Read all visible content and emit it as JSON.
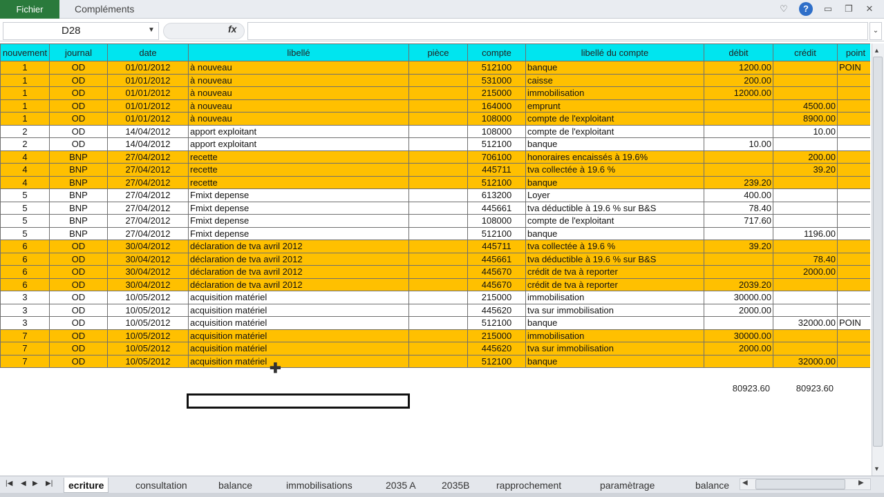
{
  "ribbon": {
    "fichier_label": "Fichier",
    "complements_label": "Compléments"
  },
  "formula_bar": {
    "name_box": "D28",
    "fx_symbol": "fx",
    "formula": ""
  },
  "table": {
    "headers": [
      "nouvement",
      "journal",
      "date",
      "libellé",
      "pièce",
      "compte",
      "libellé du compte",
      "débit",
      "crédit",
      "point"
    ],
    "rows": [
      {
        "style": "orange",
        "cells": [
          "1",
          "OD",
          "01/01/2012",
          "à nouveau",
          "",
          "512100",
          "banque",
          "1200.00",
          "",
          "POIN"
        ]
      },
      {
        "style": "orange",
        "cells": [
          "1",
          "OD",
          "01/01/2012",
          "à nouveau",
          "",
          "531000",
          "caisse",
          "200.00",
          "",
          ""
        ]
      },
      {
        "style": "orange",
        "cells": [
          "1",
          "OD",
          "01/01/2012",
          "à nouveau",
          "",
          "215000",
          "immobilisation",
          "12000.00",
          "",
          ""
        ]
      },
      {
        "style": "orange",
        "cells": [
          "1",
          "OD",
          "01/01/2012",
          "à nouveau",
          "",
          "164000",
          "emprunt",
          "",
          "4500.00",
          ""
        ]
      },
      {
        "style": "orange",
        "cells": [
          "1",
          "OD",
          "01/01/2012",
          "à nouveau",
          "",
          "108000",
          "compte de l'exploitant",
          "",
          "8900.00",
          ""
        ]
      },
      {
        "style": "white",
        "cells": [
          "2",
          "OD",
          "14/04/2012",
          "apport exploitant",
          "",
          "108000",
          "compte de l'exploitant",
          "",
          "10.00",
          ""
        ]
      },
      {
        "style": "white",
        "cells": [
          "2",
          "OD",
          "14/04/2012",
          "apport exploitant",
          "",
          "512100",
          "banque",
          "10.00",
          "",
          ""
        ]
      },
      {
        "style": "orange",
        "cells": [
          "4",
          "BNP",
          "27/04/2012",
          "recette",
          "",
          "706100",
          "honoraires encaissés à 19.6%",
          "",
          "200.00",
          ""
        ]
      },
      {
        "style": "orange",
        "cells": [
          "4",
          "BNP",
          "27/04/2012",
          "recette",
          "",
          "445711",
          "tva collectée à 19.6 %",
          "",
          "39.20",
          ""
        ]
      },
      {
        "style": "orange",
        "cells": [
          "4",
          "BNP",
          "27/04/2012",
          "recette",
          "",
          "512100",
          "banque",
          "239.20",
          "",
          ""
        ]
      },
      {
        "style": "white",
        "cells": [
          "5",
          "BNP",
          "27/04/2012",
          "Fmixt depense",
          "",
          "613200",
          "Loyer",
          "400.00",
          "",
          ""
        ]
      },
      {
        "style": "white",
        "cells": [
          "5",
          "BNP",
          "27/04/2012",
          "Fmixt depense",
          "",
          "445661",
          "tva déductible à 19.6 % sur B&S",
          "78.40",
          "",
          ""
        ]
      },
      {
        "style": "white",
        "cells": [
          "5",
          "BNP",
          "27/04/2012",
          "Fmixt depense",
          "",
          "108000",
          "compte de l'exploitant",
          "717.60",
          "",
          ""
        ]
      },
      {
        "style": "white",
        "cells": [
          "5",
          "BNP",
          "27/04/2012",
          "Fmixt depense",
          "",
          "512100",
          "banque",
          "",
          "1196.00",
          ""
        ]
      },
      {
        "style": "orange",
        "cells": [
          "6",
          "OD",
          "30/04/2012",
          "déclaration de tva avril 2012",
          "",
          "445711",
          "tva collectée à 19.6 %",
          "39.20",
          "",
          ""
        ]
      },
      {
        "style": "orange",
        "cells": [
          "6",
          "OD",
          "30/04/2012",
          "déclaration de tva avril 2012",
          "",
          "445661",
          "tva déductible à 19.6 % sur B&S",
          "",
          "78.40",
          ""
        ]
      },
      {
        "style": "orange",
        "cells": [
          "6",
          "OD",
          "30/04/2012",
          "déclaration de tva avril 2012",
          "",
          "445670",
          "crédit de tva à reporter",
          "",
          "2000.00",
          ""
        ]
      },
      {
        "style": "orange",
        "cells": [
          "6",
          "OD",
          "30/04/2012",
          "déclaration de tva avril 2012",
          "",
          "445670",
          "crédit de tva à reporter",
          "2039.20",
          "",
          ""
        ]
      },
      {
        "style": "white",
        "cells": [
          "3",
          "OD",
          "10/05/2012",
          "acquisition matériel",
          "",
          "215000",
          "immobilisation",
          "30000.00",
          "",
          ""
        ]
      },
      {
        "style": "white",
        "cells": [
          "3",
          "OD",
          "10/05/2012",
          "acquisition matériel",
          "",
          "445620",
          "tva sur immobilisation",
          "2000.00",
          "",
          ""
        ]
      },
      {
        "style": "white",
        "cells": [
          "3",
          "OD",
          "10/05/2012",
          "acquisition matériel",
          "",
          "512100",
          "banque",
          "",
          "32000.00",
          "POIN"
        ]
      },
      {
        "style": "orange",
        "cells": [
          "7",
          "OD",
          "10/05/2012",
          "acquisition matériel",
          "",
          "215000",
          "immobilisation",
          "30000.00",
          "",
          ""
        ]
      },
      {
        "style": "orange",
        "cells": [
          "7",
          "OD",
          "10/05/2012",
          "acquisition matériel",
          "",
          "445620",
          "tva sur immobilisation",
          "2000.00",
          "",
          ""
        ]
      },
      {
        "style": "orange",
        "cells": [
          "7",
          "OD",
          "10/05/2012",
          "acquisition matériel",
          "",
          "512100",
          "banque",
          "",
          "32000.00",
          ""
        ]
      }
    ]
  },
  "totals": {
    "debit": "80923.60",
    "credit": "80923.60"
  },
  "sheet_tabs": [
    "ecriture",
    "consultation",
    "balance",
    "immobilisations",
    "2035 A",
    "2035B",
    "rapprochement",
    "paramètrage",
    "balance"
  ],
  "icons": {
    "help": "help-icon",
    "minimize": "minimize-icon",
    "restore": "restore-icon",
    "close": "close-icon"
  }
}
